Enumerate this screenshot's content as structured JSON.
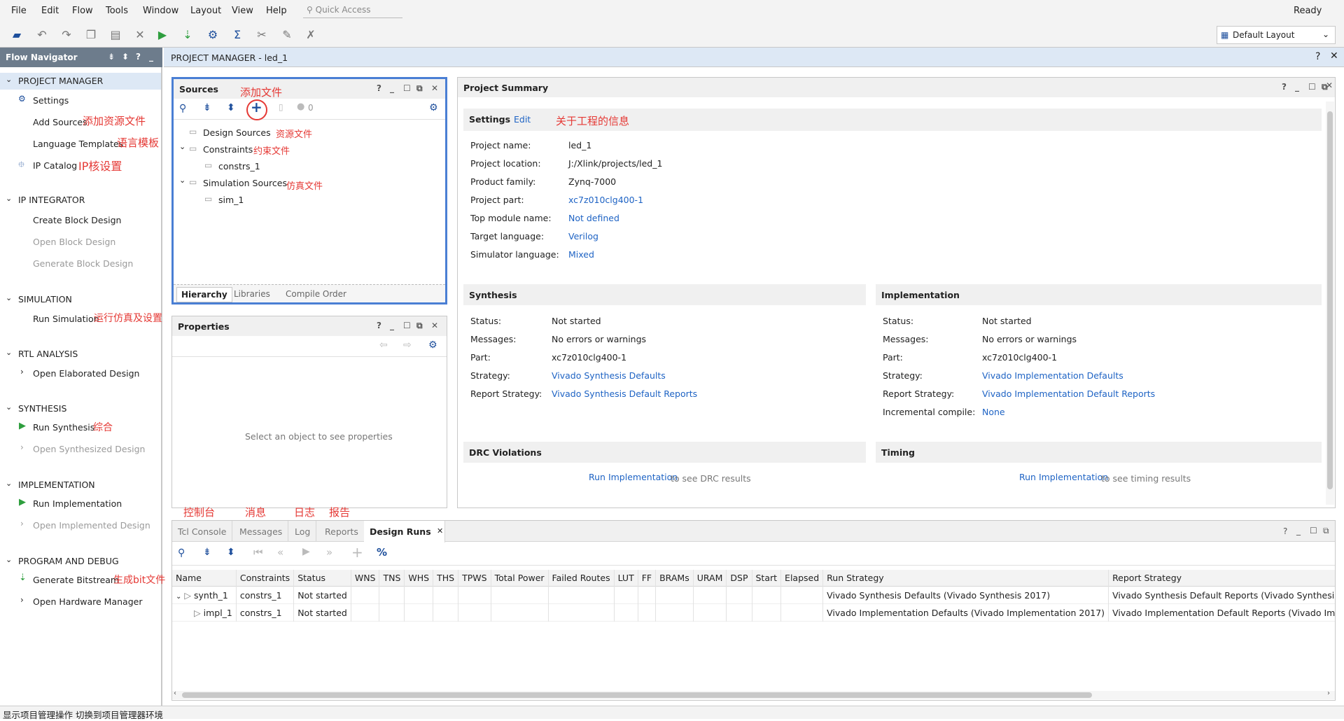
{
  "menu": {
    "items": [
      "File",
      "Edit",
      "Flow",
      "Tools",
      "Window",
      "Layout",
      "View",
      "Help"
    ],
    "quick_access_placeholder": "Quick Access",
    "status": "Ready",
    "layout_select": "Default Layout"
  },
  "flow_navigator": {
    "title": "Flow Navigator",
    "sections": {
      "project_manager": {
        "title": "PROJECT MANAGER",
        "settings": "Settings",
        "add_sources": "Add Sources",
        "language_templates": "Language Templates",
        "ip_catalog": "IP Catalog"
      },
      "ip_integrator": {
        "title": "IP INTEGRATOR",
        "create_block_design": "Create Block Design",
        "open_block_design": "Open Block Design",
        "generate_block_design": "Generate Block Design"
      },
      "simulation": {
        "title": "SIMULATION",
        "run_simulation": "Run Simulation"
      },
      "rtl_analysis": {
        "title": "RTL ANALYSIS",
        "open_elaborated_design": "Open Elaborated Design"
      },
      "synthesis": {
        "title": "SYNTHESIS",
        "run_synthesis": "Run Synthesis",
        "open_synthesized_design": "Open Synthesized Design"
      },
      "implementation": {
        "title": "IMPLEMENTATION",
        "run_implementation": "Run Implementation",
        "open_implemented_design": "Open Implemented Design"
      },
      "program_debug": {
        "title": "PROGRAM AND DEBUG",
        "generate_bitstream": "Generate Bitstream",
        "open_hardware_manager": "Open Hardware Manager"
      }
    }
  },
  "project_manager_header": "PROJECT MANAGER - led_1",
  "sources": {
    "title": "Sources",
    "badge_count": "0",
    "tree": {
      "design_sources": "Design Sources",
      "constraints": "Constraints",
      "constrs_1": "constrs_1",
      "simulation_sources": "Simulation Sources",
      "sim_1": "sim_1"
    },
    "tabs": [
      "Hierarchy",
      "Libraries",
      "Compile Order"
    ]
  },
  "properties": {
    "title": "Properties",
    "empty_message": "Select an object to see properties"
  },
  "project_summary": {
    "title": "Project Summary",
    "settings": {
      "title": "Settings",
      "edit": "Edit",
      "rows": [
        {
          "label": "Project name:",
          "value": "led_1"
        },
        {
          "label": "Project location:",
          "value": "J:/Xlink/projects/led_1"
        },
        {
          "label": "Product family:",
          "value": "Zynq-7000"
        },
        {
          "label": "Project part:",
          "value": "xc7z010clg400-1"
        },
        {
          "label": "Top module name:",
          "value": "Not defined"
        },
        {
          "label": "Target language:",
          "value": "Verilog"
        },
        {
          "label": "Simulator language:",
          "value": "Mixed"
        }
      ]
    },
    "synthesis": {
      "title": "Synthesis",
      "rows": [
        {
          "label": "Status:",
          "value": "Not started"
        },
        {
          "label": "Messages:",
          "value": "No errors or warnings"
        },
        {
          "label": "Part:",
          "value": "xc7z010clg400-1"
        },
        {
          "label": "Strategy:",
          "value": "Vivado Synthesis Defaults"
        },
        {
          "label": "Report Strategy:",
          "value": "Vivado Synthesis Default Reports"
        }
      ]
    },
    "implementation": {
      "title": "Implementation",
      "rows": [
        {
          "label": "Status:",
          "value": "Not started"
        },
        {
          "label": "Messages:",
          "value": "No errors or warnings"
        },
        {
          "label": "Part:",
          "value": "xc7z010clg400-1"
        },
        {
          "label": "Strategy:",
          "value": "Vivado Implementation Defaults"
        },
        {
          "label": "Report Strategy:",
          "value": "Vivado Implementation Default Reports"
        },
        {
          "label": "Incremental compile:",
          "value": "None"
        }
      ]
    },
    "drc": {
      "title": "DRC Violations",
      "link": "Run Implementation",
      "suffix": "to see DRC results"
    },
    "timing": {
      "title": "Timing",
      "link": "Run Implementation",
      "suffix": "to see timing results"
    }
  },
  "bottom": {
    "tabs": [
      "Tcl Console",
      "Messages",
      "Log",
      "Reports",
      "Design Runs"
    ],
    "columns": [
      "Name",
      "Constraints",
      "Status",
      "WNS",
      "TNS",
      "WHS",
      "THS",
      "TPWS",
      "Total Power",
      "Failed Routes",
      "LUT",
      "FF",
      "BRAMs",
      "URAM",
      "DSP",
      "Start",
      "Elapsed",
      "Run Strategy",
      "Report Strategy"
    ],
    "rows": [
      {
        "name": "synth_1",
        "constraints": "constrs_1",
        "status": "Not started",
        "run_strategy": "Vivado Synthesis Defaults (Vivado Synthesis 2017)",
        "report_strategy": "Vivado Synthesis Default Reports (Vivado Synthesis"
      },
      {
        "name": "impl_1",
        "constraints": "constrs_1",
        "status": "Not started",
        "run_strategy": "Vivado Implementation Defaults (Vivado Implementation 2017)",
        "report_strategy": "Vivado Implementation Default Reports (Vivado Imp"
      }
    ]
  },
  "annotations": {
    "add_file": "添加文件",
    "add_sources": "添加资源文件",
    "language_templates": "语言模板",
    "ip_catalog": "IP核设置",
    "source_files": "资源文件",
    "constraint_files": "约束文件",
    "simulation_files": "仿真文件",
    "project_info": "关于工程的信息",
    "run_simulation": "运行仿真及设置",
    "synthesis": "综合",
    "generate_bit": "生成bit文件",
    "console": "控制台",
    "messages": "消息",
    "log": "日志",
    "reports": "报告"
  },
  "status_bar": "显示项目管理操作 切换到项目管理器环境",
  "colors": {
    "accent_blue": "#1e63c4",
    "annotation_red": "#e53935",
    "run_green": "#2e9e3e",
    "nav_header": "#6d7c8c",
    "pm_header": "#dde8f5"
  }
}
